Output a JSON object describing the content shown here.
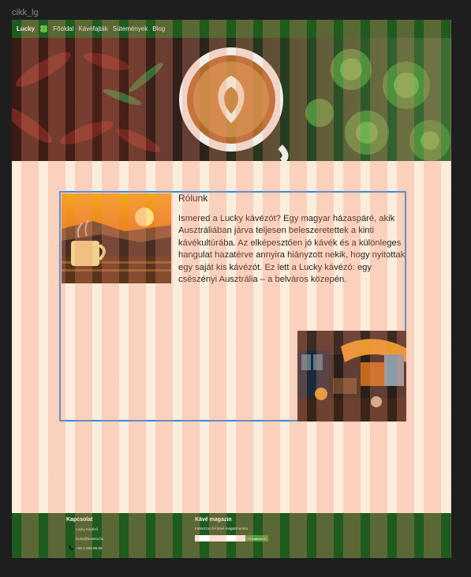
{
  "frame": {
    "label": "cikk_lg"
  },
  "navbar": {
    "brand": "Lucky",
    "brand_icon": "clover-icon",
    "links": [
      "Főoldal",
      "Kávéfajták",
      "Sütemények",
      "Blog"
    ]
  },
  "about": {
    "title": "Rólunk",
    "text": "Ismered a Lucky kávézót? Egy magyar házaspáré, akik Ausztráliában járva teljesen beleszeretettek a kinti kávékultúrába. Az elképesztően jó kávék és a különleges hangulat hazatérve annyira hiányzott nekik, hogy nyitottak egy saját kis kávézót. Ez lett a Lucky kávézó: egy csészényi Ausztrália – a belváros közepén."
  },
  "footer": {
    "contact": {
      "title": "Kapcsolat",
      "items": [
        {
          "icon": "home-icon",
          "text": "Lucky Kávéző"
        },
        {
          "icon": "mail-icon",
          "text": "lucky@kaveso.hu"
        },
        {
          "icon": "phone-icon",
          "text": "+36-1-555-55-55"
        }
      ]
    },
    "newsletter": {
      "title": "Kávé magazin",
      "subtitle": "Iratkozzon fel kávé magazinunkra",
      "input_placeholder": "",
      "button_label": "Feliratkozom"
    }
  },
  "colors": {
    "navbar": "#1f5a1f",
    "background": "#fbecdc",
    "selection": "#2b8fe6",
    "grid_column": "#f58c6e",
    "button": "#4e9a3a"
  }
}
